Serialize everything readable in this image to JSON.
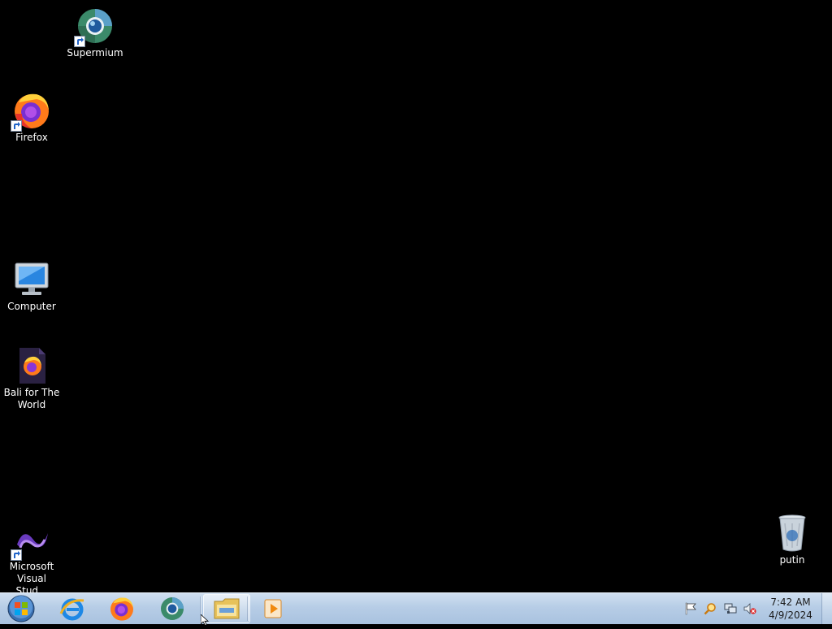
{
  "desktop": {
    "icons": [
      {
        "id": "supermium",
        "label": "Supermium",
        "icon": "supermium-icon",
        "shortcut": true
      },
      {
        "id": "firefox",
        "label": "Firefox",
        "icon": "firefox-icon",
        "shortcut": true
      },
      {
        "id": "computer",
        "label": "Computer",
        "icon": "computer-icon",
        "shortcut": false
      },
      {
        "id": "bali",
        "label": "Bali for The World",
        "icon": "firefox-document-icon",
        "shortcut": false
      },
      {
        "id": "vs",
        "label": "Microsoft Visual Stud...",
        "icon": "visual-studio-icon",
        "shortcut": true
      },
      {
        "id": "recycle",
        "label": "putin",
        "icon": "recycle-bin-icon",
        "shortcut": false
      }
    ]
  },
  "taskbar": {
    "start_button": "start-orb-icon",
    "pinned": [
      {
        "id": "ie",
        "icon": "internet-explorer-icon"
      },
      {
        "id": "firefox",
        "icon": "firefox-icon"
      },
      {
        "id": "supermium",
        "icon": "supermium-icon"
      },
      {
        "id": "explorer",
        "icon": "file-explorer-icon"
      },
      {
        "id": "media",
        "icon": "media-player-icon"
      }
    ],
    "tray": {
      "icons": [
        "action-center-flag-icon",
        "search-magnifier-icon",
        "network-icon",
        "volume-muted-icon"
      ],
      "time": "7:42 AM",
      "date": "4/9/2024"
    }
  },
  "colors": {
    "desktop_bg": "#000000",
    "taskbar_top": "#cfdff0",
    "taskbar_bottom": "#a9c2df",
    "label_text": "#ffffff"
  }
}
